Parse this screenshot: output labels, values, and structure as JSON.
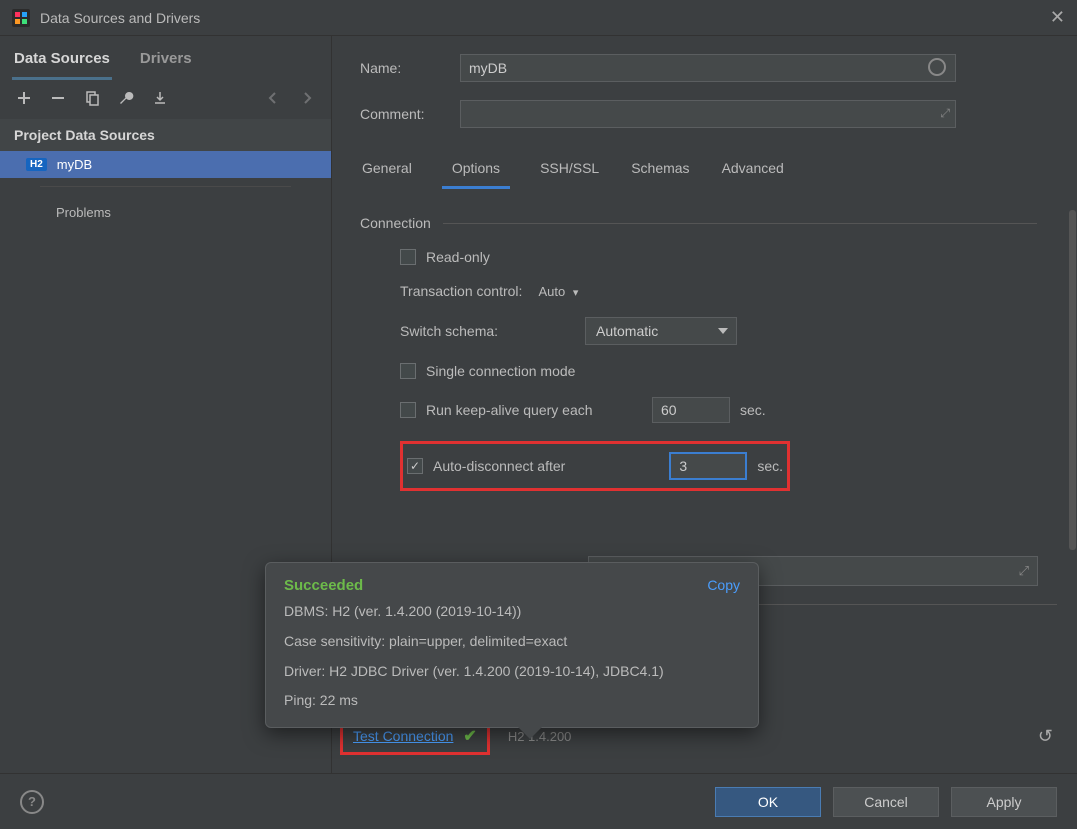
{
  "window": {
    "title": "Data Sources and Drivers"
  },
  "sidebar": {
    "tabs": {
      "data_sources": "Data Sources",
      "drivers": "Drivers"
    },
    "section": "Project Data Sources",
    "items": [
      {
        "badge": "H2",
        "label": "myDB"
      }
    ],
    "problems": "Problems"
  },
  "form": {
    "name_label": "Name:",
    "name_value": "myDB",
    "comment_label": "Comment:",
    "comment_value": ""
  },
  "tabs": {
    "general": "General",
    "options": "Options",
    "sshssl": "SSH/SSL",
    "schemas": "Schemas",
    "advanced": "Advanced"
  },
  "connection": {
    "title": "Connection",
    "read_only": "Read-only",
    "transaction_label": "Transaction control:",
    "transaction_value": "Auto",
    "switch_label": "Switch schema:",
    "switch_value": "Automatic",
    "single_conn": "Single connection mode",
    "keepalive": "Run keep-alive query each",
    "keepalive_value": "60",
    "autodisc": "Auto-disconnect after",
    "autodisc_value": "3",
    "sec": "sec."
  },
  "test": {
    "label": "Test Connection",
    "version": "H2 1.4.200"
  },
  "tooltip": {
    "status": "Succeeded",
    "copy": "Copy",
    "dbms": "DBMS: H2 (ver. 1.4.200 (2019-10-14))",
    "case": "Case sensitivity: plain=upper, delimited=exact",
    "driver": "Driver: H2 JDBC Driver (ver. 1.4.200 (2019-10-14), JDBC4.1)",
    "ping": "Ping: 22 ms"
  },
  "buttons": {
    "ok": "OK",
    "cancel": "Cancel",
    "apply": "Apply"
  }
}
